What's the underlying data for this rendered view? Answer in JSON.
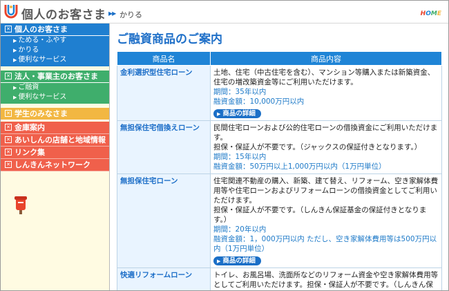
{
  "header": {
    "title": "個人のお客さま",
    "breadcrumb": "かりる",
    "home_letters": [
      "H",
      "O",
      "M",
      "E"
    ],
    "home_colors": [
      "#e8442c",
      "#1f84d6",
      "#3fae6c",
      "#f2b742"
    ]
  },
  "sidebar": {
    "personal": {
      "label": "個人のお客さま",
      "subs": [
        "ためる・ふやす",
        "かりる",
        "便利なサービス"
      ]
    },
    "corporate": {
      "label": "法人・事業主のお客さま",
      "subs": [
        "ご融資",
        "便利なサービス"
      ]
    },
    "students": {
      "label": "学生のみなさま"
    },
    "links": [
      "金庫案内",
      "あいしんの店舗と地域情報",
      "リンク集",
      "しんきんネットワーク"
    ]
  },
  "main": {
    "title": "ご融資商品のご案内",
    "col_name": "商品名",
    "col_content": "商品内容",
    "detail_label": "商品の詳細",
    "products": [
      {
        "name": "金利選択型住宅ローン",
        "desc": [
          "土地、住宅（中古住宅を含む）、マンション等購入または新築資金、住宅の増改築資金等にご利用いただけます。"
        ],
        "terms": [
          "期間：35年以内",
          "融資金額：10,000万円以内"
        ]
      },
      {
        "name": "無担保住宅借換えローン",
        "desc": [
          "民間住宅ローンおよび公的住宅ローンの借換資金にご利用いただけます。",
          "担保・保証人が不要です。（ジャックスの保証付きとなります。）"
        ],
        "terms": [
          "期間：15年以内",
          "融資金額：50万円以上1,000万円以内（1万円単位）"
        ]
      },
      {
        "name": "無担保住宅ローン",
        "desc": [
          "住宅関連不動産の購入、新築、建て替え、リフォーム、空き家解体費用等や住宅ローンおよびリフォームローンの借換資金としてご利用いただけます。",
          "担保・保証人が不要です。（しんきん保証基金の保証付きとなります。）"
        ],
        "terms": [
          "期間：20年以内",
          "融資金額：1，000万円以内 ただし、空き家解体費用等は500万円以内（1万円単位）"
        ]
      },
      {
        "name": "快適リフォームローン",
        "desc": [
          "トイレ、お風呂場、洗面所などのリフォーム資金や空き家解体費用等としてご利用いただけます。担保・保証人が不要です。（しんきん保証"
        ],
        "terms": []
      }
    ]
  }
}
